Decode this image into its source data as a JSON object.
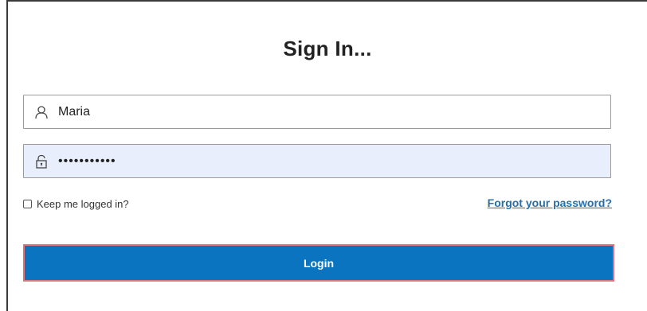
{
  "form": {
    "title": "Sign In...",
    "username": {
      "value": "Maria",
      "icon": "user-icon"
    },
    "password": {
      "value": "•••••••••••",
      "icon": "lock-icon"
    },
    "remember_label": "Keep me logged in?",
    "remember_checked": false,
    "forgot_label": "Forgot your password?",
    "login_label": "Login"
  },
  "colors": {
    "button_bg": "#0a74c1",
    "button_border": "#e0737c",
    "link": "#2a6ea8",
    "password_field_bg": "#e8eefb"
  }
}
